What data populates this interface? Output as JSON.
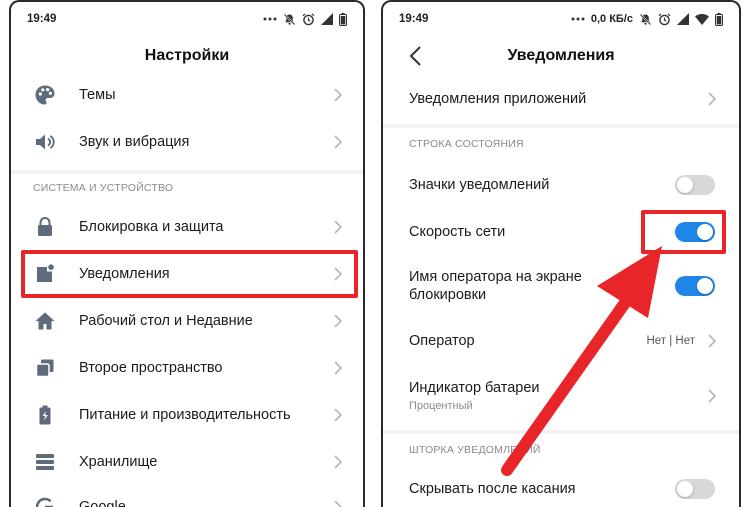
{
  "colors": {
    "accent_blue": "#1f86e8",
    "highlight_red": "#e8262a",
    "icon_gray": "#5f6b7a",
    "section_gray": "#8a8a8a"
  },
  "left_screen": {
    "status": {
      "time": "19:49"
    },
    "title": "Настройки",
    "items_top": [
      {
        "label": "Темы",
        "icon": "palette-icon"
      },
      {
        "label": "Звук и вибрация",
        "icon": "speaker-icon"
      }
    ],
    "section_header": "СИСТЕМА И УСТРОЙСТВО",
    "items_system": [
      {
        "label": "Блокировка и защита",
        "icon": "lock-icon"
      },
      {
        "label": "Уведомления",
        "icon": "notification-icon"
      },
      {
        "label": "Рабочий стол и Недавние",
        "icon": "home-icon"
      },
      {
        "label": "Второе пространство",
        "icon": "second-space-icon"
      },
      {
        "label": "Питание и производительность",
        "icon": "battery-bolt-icon"
      },
      {
        "label": "Хранилище",
        "icon": "storage-icon"
      },
      {
        "label": "Google",
        "icon": "google-icon"
      }
    ]
  },
  "right_screen": {
    "status": {
      "time": "19:49",
      "net_speed": "0,0 КБ/с"
    },
    "title": "Уведомления",
    "app_notifications": "Уведомления приложений",
    "section_status_bar": "СТРОКА СОСТОЯНИЯ",
    "notification_icons": {
      "label": "Значки уведомлений",
      "enabled": false
    },
    "network_speed": {
      "label": "Скорость сети",
      "enabled": true
    },
    "carrier_lockscreen": {
      "label_line1": "Имя оператора на экране",
      "label_line2": "блокировки",
      "enabled": true
    },
    "carrier": {
      "label": "Оператор",
      "value": "Нет | Нет"
    },
    "battery_indicator": {
      "label": "Индикатор батареи",
      "sub": "Процентный"
    },
    "section_shade": "ШТОРКА УВЕДОМЛЕНИЙ",
    "hide_after_tap": {
      "label": "Скрывать после касания",
      "enabled": false
    }
  }
}
